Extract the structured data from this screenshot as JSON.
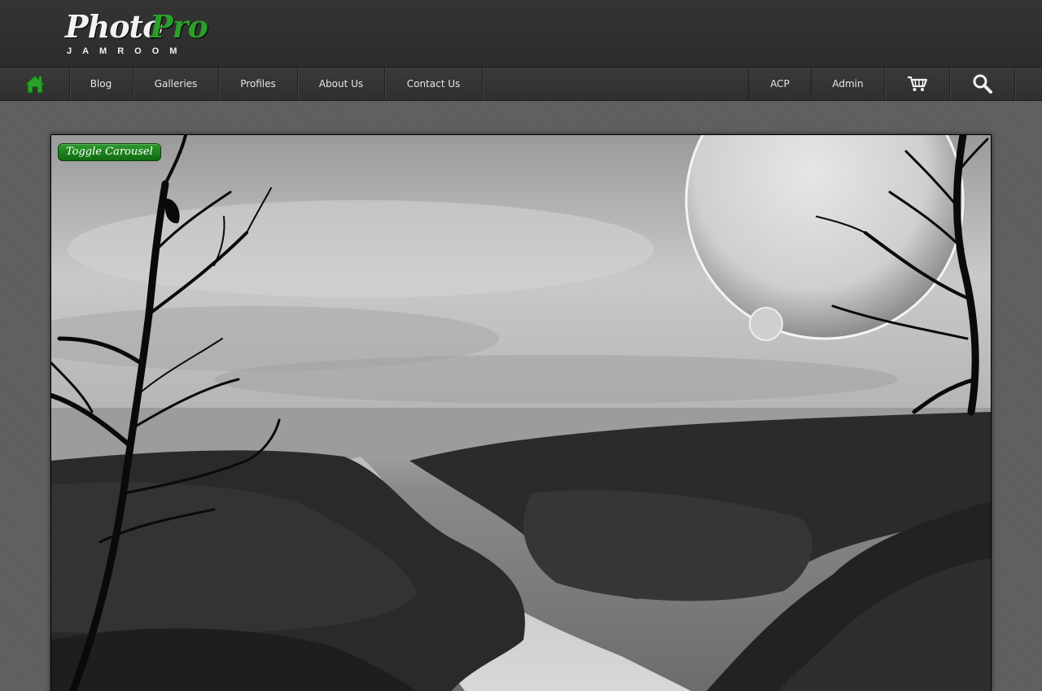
{
  "logo": {
    "word1": "Photo",
    "word2": "Pro",
    "subtitle": "JAMROOM"
  },
  "nav": {
    "home_icon": "home-icon",
    "left_items": [
      "Blog",
      "Galleries",
      "Profiles",
      "About Us",
      "Contact Us"
    ],
    "right_items": [
      "ACP",
      "Admin"
    ],
    "cart_icon": "cart-icon",
    "search_icon": "search-icon"
  },
  "carousel": {
    "toggle_label": "Toggle Carousel"
  },
  "colors": {
    "accent_green": "#2aa02a",
    "header_bg": "#333333",
    "page_bg": "#5f5f5f"
  }
}
